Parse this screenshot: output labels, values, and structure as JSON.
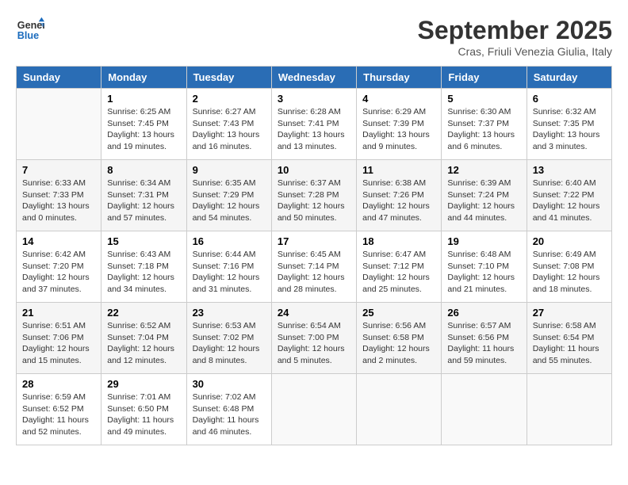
{
  "logo": {
    "line1": "General",
    "line2": "Blue"
  },
  "title": "September 2025",
  "subtitle": "Cras, Friuli Venezia Giulia, Italy",
  "weekdays": [
    "Sunday",
    "Monday",
    "Tuesday",
    "Wednesday",
    "Thursday",
    "Friday",
    "Saturday"
  ],
  "weeks": [
    [
      {
        "day": "",
        "info": ""
      },
      {
        "day": "1",
        "info": "Sunrise: 6:25 AM\nSunset: 7:45 PM\nDaylight: 13 hours\nand 19 minutes."
      },
      {
        "day": "2",
        "info": "Sunrise: 6:27 AM\nSunset: 7:43 PM\nDaylight: 13 hours\nand 16 minutes."
      },
      {
        "day": "3",
        "info": "Sunrise: 6:28 AM\nSunset: 7:41 PM\nDaylight: 13 hours\nand 13 minutes."
      },
      {
        "day": "4",
        "info": "Sunrise: 6:29 AM\nSunset: 7:39 PM\nDaylight: 13 hours\nand 9 minutes."
      },
      {
        "day": "5",
        "info": "Sunrise: 6:30 AM\nSunset: 7:37 PM\nDaylight: 13 hours\nand 6 minutes."
      },
      {
        "day": "6",
        "info": "Sunrise: 6:32 AM\nSunset: 7:35 PM\nDaylight: 13 hours\nand 3 minutes."
      }
    ],
    [
      {
        "day": "7",
        "info": "Sunrise: 6:33 AM\nSunset: 7:33 PM\nDaylight: 13 hours\nand 0 minutes."
      },
      {
        "day": "8",
        "info": "Sunrise: 6:34 AM\nSunset: 7:31 PM\nDaylight: 12 hours\nand 57 minutes."
      },
      {
        "day": "9",
        "info": "Sunrise: 6:35 AM\nSunset: 7:29 PM\nDaylight: 12 hours\nand 54 minutes."
      },
      {
        "day": "10",
        "info": "Sunrise: 6:37 AM\nSunset: 7:28 PM\nDaylight: 12 hours\nand 50 minutes."
      },
      {
        "day": "11",
        "info": "Sunrise: 6:38 AM\nSunset: 7:26 PM\nDaylight: 12 hours\nand 47 minutes."
      },
      {
        "day": "12",
        "info": "Sunrise: 6:39 AM\nSunset: 7:24 PM\nDaylight: 12 hours\nand 44 minutes."
      },
      {
        "day": "13",
        "info": "Sunrise: 6:40 AM\nSunset: 7:22 PM\nDaylight: 12 hours\nand 41 minutes."
      }
    ],
    [
      {
        "day": "14",
        "info": "Sunrise: 6:42 AM\nSunset: 7:20 PM\nDaylight: 12 hours\nand 37 minutes."
      },
      {
        "day": "15",
        "info": "Sunrise: 6:43 AM\nSunset: 7:18 PM\nDaylight: 12 hours\nand 34 minutes."
      },
      {
        "day": "16",
        "info": "Sunrise: 6:44 AM\nSunset: 7:16 PM\nDaylight: 12 hours\nand 31 minutes."
      },
      {
        "day": "17",
        "info": "Sunrise: 6:45 AM\nSunset: 7:14 PM\nDaylight: 12 hours\nand 28 minutes."
      },
      {
        "day": "18",
        "info": "Sunrise: 6:47 AM\nSunset: 7:12 PM\nDaylight: 12 hours\nand 25 minutes."
      },
      {
        "day": "19",
        "info": "Sunrise: 6:48 AM\nSunset: 7:10 PM\nDaylight: 12 hours\nand 21 minutes."
      },
      {
        "day": "20",
        "info": "Sunrise: 6:49 AM\nSunset: 7:08 PM\nDaylight: 12 hours\nand 18 minutes."
      }
    ],
    [
      {
        "day": "21",
        "info": "Sunrise: 6:51 AM\nSunset: 7:06 PM\nDaylight: 12 hours\nand 15 minutes."
      },
      {
        "day": "22",
        "info": "Sunrise: 6:52 AM\nSunset: 7:04 PM\nDaylight: 12 hours\nand 12 minutes."
      },
      {
        "day": "23",
        "info": "Sunrise: 6:53 AM\nSunset: 7:02 PM\nDaylight: 12 hours\nand 8 minutes."
      },
      {
        "day": "24",
        "info": "Sunrise: 6:54 AM\nSunset: 7:00 PM\nDaylight: 12 hours\nand 5 minutes."
      },
      {
        "day": "25",
        "info": "Sunrise: 6:56 AM\nSunset: 6:58 PM\nDaylight: 12 hours\nand 2 minutes."
      },
      {
        "day": "26",
        "info": "Sunrise: 6:57 AM\nSunset: 6:56 PM\nDaylight: 11 hours\nand 59 minutes."
      },
      {
        "day": "27",
        "info": "Sunrise: 6:58 AM\nSunset: 6:54 PM\nDaylight: 11 hours\nand 55 minutes."
      }
    ],
    [
      {
        "day": "28",
        "info": "Sunrise: 6:59 AM\nSunset: 6:52 PM\nDaylight: 11 hours\nand 52 minutes."
      },
      {
        "day": "29",
        "info": "Sunrise: 7:01 AM\nSunset: 6:50 PM\nDaylight: 11 hours\nand 49 minutes."
      },
      {
        "day": "30",
        "info": "Sunrise: 7:02 AM\nSunset: 6:48 PM\nDaylight: 11 hours\nand 46 minutes."
      },
      {
        "day": "",
        "info": ""
      },
      {
        "day": "",
        "info": ""
      },
      {
        "day": "",
        "info": ""
      },
      {
        "day": "",
        "info": ""
      }
    ]
  ]
}
